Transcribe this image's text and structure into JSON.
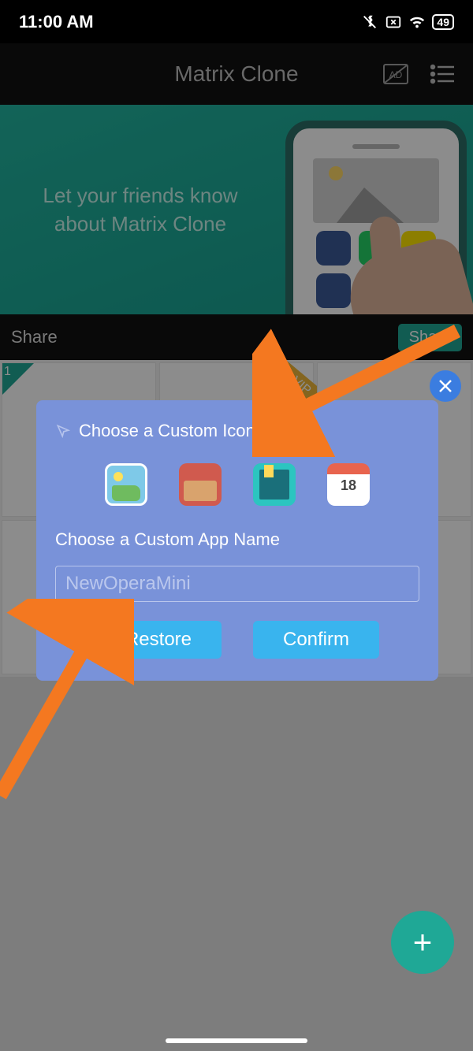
{
  "status": {
    "time": "11:00 AM",
    "battery": "49"
  },
  "header": {
    "title": "Matrix Clone"
  },
  "banner": {
    "text": "Let your friends know about Matrix Clone"
  },
  "shareRow": {
    "label": "Share",
    "button": "Share"
  },
  "grid": {
    "badge": "1",
    "vip": "VIP"
  },
  "modal": {
    "iconTitle": "Choose a Custom Icon",
    "nameTitle": "Choose a Custom App Name",
    "inputValue": "NewOperaMini",
    "calendarNum": "18",
    "restore": "Restore",
    "confirm": "Confirm"
  },
  "fab": {
    "symbol": "+"
  }
}
